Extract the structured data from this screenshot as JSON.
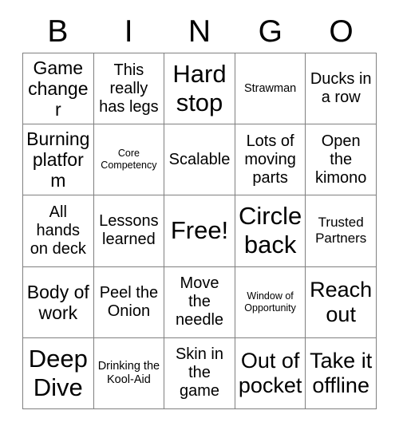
{
  "card": {
    "title": "BINGO",
    "header_letters": [
      "B",
      "I",
      "N",
      "G",
      "O"
    ],
    "grid_size": "5x5",
    "free_space": "Free!",
    "colors": {
      "text": "#000000",
      "background": "#ffffff",
      "grid_line": "#808080"
    },
    "rows": [
      [
        {
          "text": "Game changer",
          "size": "lg"
        },
        {
          "text": "This really has legs",
          "size": "md"
        },
        {
          "text": "Hard stop",
          "size": "xxl"
        },
        {
          "text": "Strawman",
          "size": "xs"
        },
        {
          "text": "Ducks in a row",
          "size": "md"
        }
      ],
      [
        {
          "text": "Burning platform",
          "size": "lg"
        },
        {
          "text": "Core Competency",
          "size": "xxs"
        },
        {
          "text": "Scalable",
          "size": "md"
        },
        {
          "text": "Lots of moving parts",
          "size": "md"
        },
        {
          "text": "Open the kimono",
          "size": "md"
        }
      ],
      [
        {
          "text": "All hands on deck",
          "size": "md"
        },
        {
          "text": "Lessons learned",
          "size": "md"
        },
        {
          "text": "Free!",
          "size": "xxl"
        },
        {
          "text": "Circle back",
          "size": "xxl"
        },
        {
          "text": "Trusted Partners",
          "size": "sm"
        }
      ],
      [
        {
          "text": "Body of work",
          "size": "lg"
        },
        {
          "text": "Peel the Onion",
          "size": "md"
        },
        {
          "text": "Move the needle",
          "size": "md"
        },
        {
          "text": "Window of Opportunity",
          "size": "xxs"
        },
        {
          "text": "Reach out",
          "size": "xl"
        }
      ],
      [
        {
          "text": "Deep Dive",
          "size": "xxl"
        },
        {
          "text": "Drinking the Kool-Aid",
          "size": "xs"
        },
        {
          "text": "Skin in the game",
          "size": "md"
        },
        {
          "text": "Out of pocket",
          "size": "xl"
        },
        {
          "text": "Take it offline",
          "size": "xl"
        }
      ]
    ]
  }
}
